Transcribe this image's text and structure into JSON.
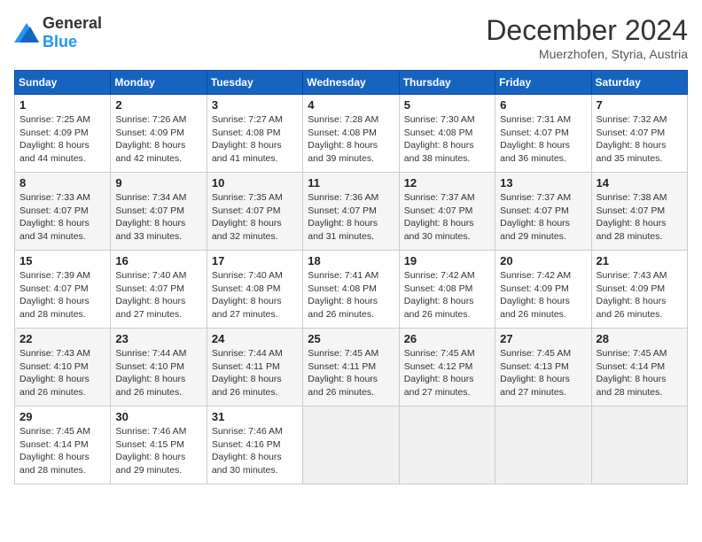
{
  "logo": {
    "general": "General",
    "blue": "Blue"
  },
  "header": {
    "month": "December 2024",
    "location": "Muerzhofen, Styria, Austria"
  },
  "days_of_week": [
    "Sunday",
    "Monday",
    "Tuesday",
    "Wednesday",
    "Thursday",
    "Friday",
    "Saturday"
  ],
  "weeks": [
    [
      {
        "day": "1",
        "sunrise": "Sunrise: 7:25 AM",
        "sunset": "Sunset: 4:09 PM",
        "daylight": "Daylight: 8 hours and 44 minutes."
      },
      {
        "day": "2",
        "sunrise": "Sunrise: 7:26 AM",
        "sunset": "Sunset: 4:09 PM",
        "daylight": "Daylight: 8 hours and 42 minutes."
      },
      {
        "day": "3",
        "sunrise": "Sunrise: 7:27 AM",
        "sunset": "Sunset: 4:08 PM",
        "daylight": "Daylight: 8 hours and 41 minutes."
      },
      {
        "day": "4",
        "sunrise": "Sunrise: 7:28 AM",
        "sunset": "Sunset: 4:08 PM",
        "daylight": "Daylight: 8 hours and 39 minutes."
      },
      {
        "day": "5",
        "sunrise": "Sunrise: 7:30 AM",
        "sunset": "Sunset: 4:08 PM",
        "daylight": "Daylight: 8 hours and 38 minutes."
      },
      {
        "day": "6",
        "sunrise": "Sunrise: 7:31 AM",
        "sunset": "Sunset: 4:07 PM",
        "daylight": "Daylight: 8 hours and 36 minutes."
      },
      {
        "day": "7",
        "sunrise": "Sunrise: 7:32 AM",
        "sunset": "Sunset: 4:07 PM",
        "daylight": "Daylight: 8 hours and 35 minutes."
      }
    ],
    [
      {
        "day": "8",
        "sunrise": "Sunrise: 7:33 AM",
        "sunset": "Sunset: 4:07 PM",
        "daylight": "Daylight: 8 hours and 34 minutes."
      },
      {
        "day": "9",
        "sunrise": "Sunrise: 7:34 AM",
        "sunset": "Sunset: 4:07 PM",
        "daylight": "Daylight: 8 hours and 33 minutes."
      },
      {
        "day": "10",
        "sunrise": "Sunrise: 7:35 AM",
        "sunset": "Sunset: 4:07 PM",
        "daylight": "Daylight: 8 hours and 32 minutes."
      },
      {
        "day": "11",
        "sunrise": "Sunrise: 7:36 AM",
        "sunset": "Sunset: 4:07 PM",
        "daylight": "Daylight: 8 hours and 31 minutes."
      },
      {
        "day": "12",
        "sunrise": "Sunrise: 7:37 AM",
        "sunset": "Sunset: 4:07 PM",
        "daylight": "Daylight: 8 hours and 30 minutes."
      },
      {
        "day": "13",
        "sunrise": "Sunrise: 7:37 AM",
        "sunset": "Sunset: 4:07 PM",
        "daylight": "Daylight: 8 hours and 29 minutes."
      },
      {
        "day": "14",
        "sunrise": "Sunrise: 7:38 AM",
        "sunset": "Sunset: 4:07 PM",
        "daylight": "Daylight: 8 hours and 28 minutes."
      }
    ],
    [
      {
        "day": "15",
        "sunrise": "Sunrise: 7:39 AM",
        "sunset": "Sunset: 4:07 PM",
        "daylight": "Daylight: 8 hours and 28 minutes."
      },
      {
        "day": "16",
        "sunrise": "Sunrise: 7:40 AM",
        "sunset": "Sunset: 4:07 PM",
        "daylight": "Daylight: 8 hours and 27 minutes."
      },
      {
        "day": "17",
        "sunrise": "Sunrise: 7:40 AM",
        "sunset": "Sunset: 4:08 PM",
        "daylight": "Daylight: 8 hours and 27 minutes."
      },
      {
        "day": "18",
        "sunrise": "Sunrise: 7:41 AM",
        "sunset": "Sunset: 4:08 PM",
        "daylight": "Daylight: 8 hours and 26 minutes."
      },
      {
        "day": "19",
        "sunrise": "Sunrise: 7:42 AM",
        "sunset": "Sunset: 4:08 PM",
        "daylight": "Daylight: 8 hours and 26 minutes."
      },
      {
        "day": "20",
        "sunrise": "Sunrise: 7:42 AM",
        "sunset": "Sunset: 4:09 PM",
        "daylight": "Daylight: 8 hours and 26 minutes."
      },
      {
        "day": "21",
        "sunrise": "Sunrise: 7:43 AM",
        "sunset": "Sunset: 4:09 PM",
        "daylight": "Daylight: 8 hours and 26 minutes."
      }
    ],
    [
      {
        "day": "22",
        "sunrise": "Sunrise: 7:43 AM",
        "sunset": "Sunset: 4:10 PM",
        "daylight": "Daylight: 8 hours and 26 minutes."
      },
      {
        "day": "23",
        "sunrise": "Sunrise: 7:44 AM",
        "sunset": "Sunset: 4:10 PM",
        "daylight": "Daylight: 8 hours and 26 minutes."
      },
      {
        "day": "24",
        "sunrise": "Sunrise: 7:44 AM",
        "sunset": "Sunset: 4:11 PM",
        "daylight": "Daylight: 8 hours and 26 minutes."
      },
      {
        "day": "25",
        "sunrise": "Sunrise: 7:45 AM",
        "sunset": "Sunset: 4:11 PM",
        "daylight": "Daylight: 8 hours and 26 minutes."
      },
      {
        "day": "26",
        "sunrise": "Sunrise: 7:45 AM",
        "sunset": "Sunset: 4:12 PM",
        "daylight": "Daylight: 8 hours and 27 minutes."
      },
      {
        "day": "27",
        "sunrise": "Sunrise: 7:45 AM",
        "sunset": "Sunset: 4:13 PM",
        "daylight": "Daylight: 8 hours and 27 minutes."
      },
      {
        "day": "28",
        "sunrise": "Sunrise: 7:45 AM",
        "sunset": "Sunset: 4:14 PM",
        "daylight": "Daylight: 8 hours and 28 minutes."
      }
    ],
    [
      {
        "day": "29",
        "sunrise": "Sunrise: 7:45 AM",
        "sunset": "Sunset: 4:14 PM",
        "daylight": "Daylight: 8 hours and 28 minutes."
      },
      {
        "day": "30",
        "sunrise": "Sunrise: 7:46 AM",
        "sunset": "Sunset: 4:15 PM",
        "daylight": "Daylight: 8 hours and 29 minutes."
      },
      {
        "day": "31",
        "sunrise": "Sunrise: 7:46 AM",
        "sunset": "Sunset: 4:16 PM",
        "daylight": "Daylight: 8 hours and 30 minutes."
      },
      null,
      null,
      null,
      null
    ]
  ]
}
